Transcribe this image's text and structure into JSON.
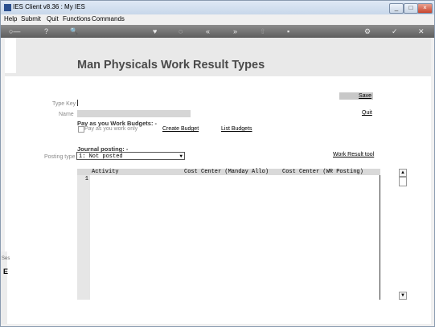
{
  "window": {
    "title": "IES Client v8.36 : My IES",
    "min": "_",
    "max": "□",
    "close": "×"
  },
  "menu": [
    "Help",
    "Submit",
    "Quit",
    "Functions",
    "Commands"
  ],
  "toolbar": {
    "icons": [
      "key-icon",
      "help-icon",
      "search-icon",
      "heart-icon",
      "refresh-icon",
      "rewind-icon",
      "fast-forward-icon",
      "upload-icon",
      "stop-icon",
      "gear-icon",
      "check-icon",
      "close-icon"
    ],
    "glyphs": [
      "○—",
      "?",
      "🔍",
      "♥",
      "◌",
      "«",
      "»",
      "⇧",
      "▪",
      "⚙",
      "✓",
      "✕"
    ]
  },
  "page": {
    "title": "Man Physicals Work Result Types",
    "save": "Save",
    "quit": "Quit",
    "type_key_label": "Type Key",
    "name_label": "Name",
    "budgets_heading": "Pay as you Work Budgets: -",
    "pay_only": "Pay as you work only",
    "create_budget": "Create Budget",
    "list_budgets": "List Budgets",
    "journal_heading": "Journal posting: -",
    "posting_type_label": "Posting type",
    "posting_type_value": "1: Not posted",
    "work_result_tool": "Work Result tool"
  },
  "grid": {
    "columns": [
      "Activity",
      "Cost Center (Manday Allo)",
      "Cost Center (WR Posting)"
    ],
    "row_numbers": [
      "1"
    ]
  },
  "left_strip": {
    "text": "Ses",
    "glyph": "E"
  }
}
